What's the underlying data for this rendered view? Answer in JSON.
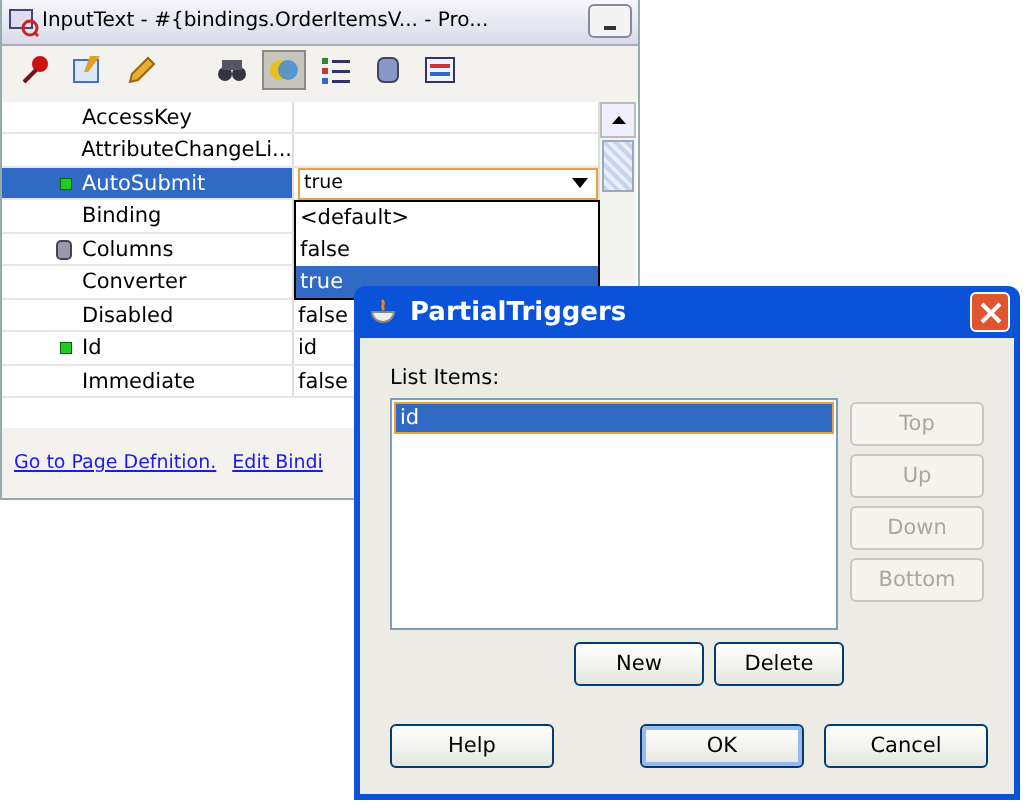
{
  "panel": {
    "title": "InputText - #{bindings.OrderItemsV... - Pro...",
    "toolbar": [
      {
        "selected": false
      },
      {
        "selected": false
      },
      {
        "selected": false
      },
      {
        "selected": false
      },
      {
        "selected": true
      },
      {
        "selected": false
      },
      {
        "selected": false
      },
      {
        "selected": false
      }
    ],
    "rows": [
      {
        "name": "AccessKey",
        "selected": false
      },
      {
        "name": "AttributeChangeLi...",
        "selected": false
      },
      {
        "name": "AutoSubmit",
        "kind": "set",
        "selected": true
      },
      {
        "name": "Binding",
        "selected": false
      },
      {
        "name": "Columns",
        "kind": "group",
        "selected": false
      },
      {
        "name": "Converter",
        "selected": false
      },
      {
        "name": "Disabled",
        "value": "false",
        "selected": false
      },
      {
        "name": "Id",
        "kind": "set",
        "value": "id",
        "selected": false
      },
      {
        "name": "Immediate",
        "value": "false",
        "selected": false
      }
    ],
    "combo": {
      "value": "true",
      "options": [
        {
          "label": "<default>",
          "selected": false
        },
        {
          "label": "false",
          "selected": false
        },
        {
          "label": "true",
          "selected": true
        }
      ]
    },
    "links": [
      "Go to Page Defnition.",
      "Edit Bindi"
    ]
  },
  "dialog": {
    "title": "PartialTriggers",
    "list_label": "List Items:",
    "items": [
      {
        "label": "id",
        "selected": true
      }
    ],
    "side_buttons": [
      {
        "label": "Top",
        "disabled": true
      },
      {
        "label": "Up",
        "disabled": true
      },
      {
        "label": "Down",
        "disabled": true
      },
      {
        "label": "Bottom",
        "disabled": true
      }
    ],
    "list_buttons": [
      "New",
      "Delete"
    ],
    "help": "Help",
    "ok": "OK",
    "cancel": "Cancel"
  }
}
